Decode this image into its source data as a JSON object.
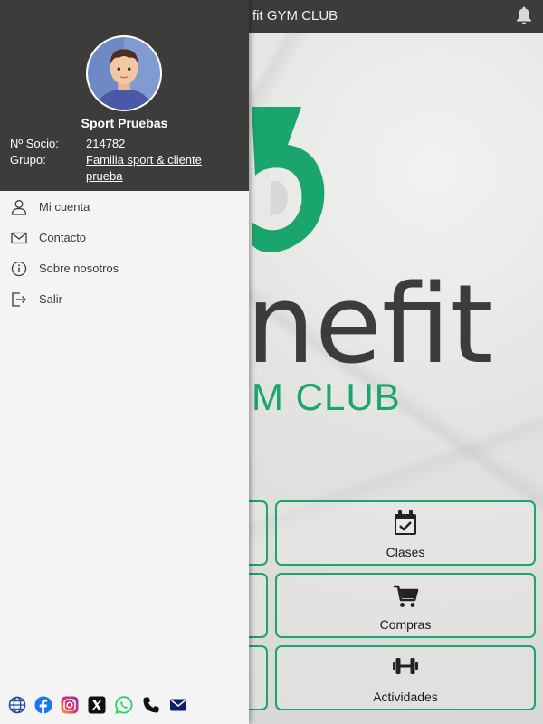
{
  "header": {
    "title": "fit GYM CLUB"
  },
  "brand": {
    "logo_text": "nefit",
    "logo_subtitle": "M CLUB",
    "accent": "#19a56b",
    "dark": "#3c3c3b"
  },
  "cards": [
    {
      "label": "Clases",
      "icon": "calendar-check-icon"
    },
    {
      "label": "Compras",
      "icon": "shopping-cart-icon"
    },
    {
      "label": "Actividades",
      "icon": "dumbbell-icon"
    }
  ],
  "drawer": {
    "user_name": "Sport Pruebas",
    "socio_label": "Nº Socio:",
    "socio_value": "214782",
    "grupo_label": "Grupo:",
    "grupo_value": "Familia sport & cliente prueba",
    "menu": [
      {
        "label": "Mi cuenta",
        "icon": "user-icon"
      },
      {
        "label": "Contacto",
        "icon": "mail-icon"
      },
      {
        "label": "Sobre nosotros",
        "icon": "info-icon"
      },
      {
        "label": "Salir",
        "icon": "logout-icon"
      }
    ],
    "social": [
      "globe-icon",
      "facebook-icon",
      "instagram-icon",
      "x-icon",
      "whatsapp-icon",
      "phone-icon",
      "email-icon"
    ]
  }
}
